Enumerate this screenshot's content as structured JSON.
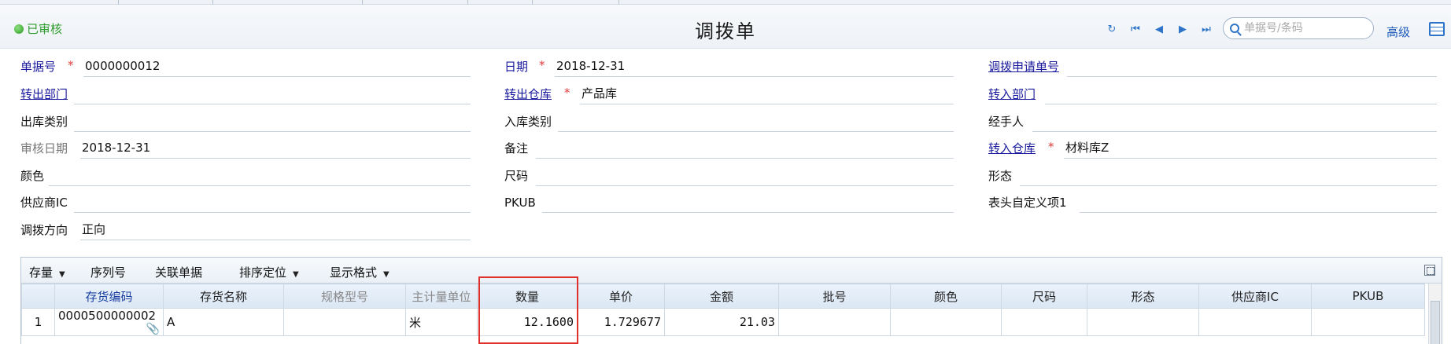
{
  "header": {
    "status": "已审核",
    "title": "调拨单",
    "search_placeholder": "单据号/条码",
    "advanced": "高级"
  },
  "form": {
    "left": [
      {
        "label": "单据号",
        "value": "0000000012"
      },
      {
        "label": "转出部门",
        "value": ""
      },
      {
        "label": "出库类别",
        "value": ""
      },
      {
        "label": "审核日期",
        "value": "2018-12-31"
      },
      {
        "label": "颜色",
        "value": ""
      },
      {
        "label": "供应商IC",
        "value": ""
      },
      {
        "label": "调拨方向",
        "value": "正向"
      }
    ],
    "middle": [
      {
        "label": "日期",
        "value": "2018-12-31"
      },
      {
        "label": "转出仓库",
        "value": "产品库"
      },
      {
        "label": "入库类别",
        "value": ""
      },
      {
        "label": "备注",
        "value": ""
      },
      {
        "label": "尺码",
        "value": ""
      },
      {
        "label": "PKUB",
        "value": ""
      }
    ],
    "right": [
      {
        "label": "调拨申请单号",
        "value": ""
      },
      {
        "label": "转入部门",
        "value": ""
      },
      {
        "label": "经手人",
        "value": ""
      },
      {
        "label": "转入仓库",
        "value": "材料库Z"
      },
      {
        "label": "形态",
        "value": ""
      },
      {
        "label": "表头自定义项1",
        "value": ""
      }
    ]
  },
  "toolbar": {
    "stock": "存量",
    "serial": "序列号",
    "related": "关联单据",
    "sort": "排序定位",
    "format": "显示格式"
  },
  "table": {
    "columns": [
      "存货编码",
      "存货名称",
      "规格型号",
      "主计量单位",
      "数量",
      "单价",
      "金额",
      "批号",
      "颜色",
      "尺码",
      "形态",
      "供应商IC",
      "PKUB"
    ],
    "rows": [
      {
        "no": "1",
        "code": "0000500000002",
        "name": "A",
        "spec": "",
        "unit": "米",
        "qty": "12.1600",
        "price": "1.729677",
        "amount": "21.03",
        "batch": "",
        "color": "",
        "size": "",
        "form": "",
        "supplier": "",
        "pkub": ""
      }
    ]
  },
  "colors": {
    "accent": "#2d74c8",
    "highlight": "#e0302c",
    "required": "#e23b3b"
  }
}
